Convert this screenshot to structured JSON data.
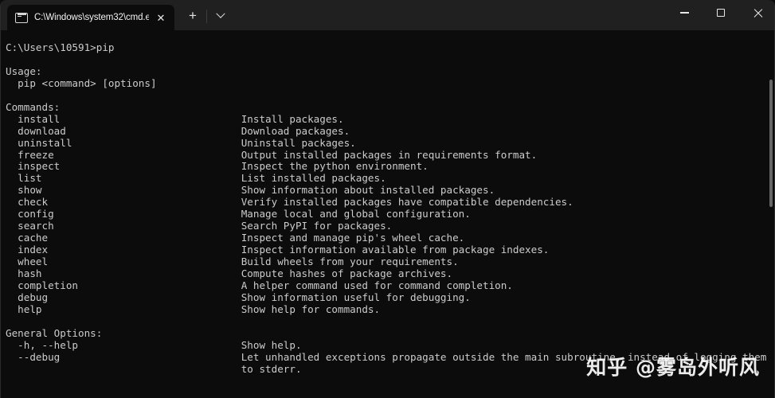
{
  "window": {
    "titlebar": {
      "tab": {
        "icon": "console-icon",
        "title": "C:\\Windows\\system32\\cmd.e:",
        "close_label": "✕"
      },
      "new_tab_label": "+",
      "dropdown_label": "⌄",
      "controls": {
        "minimize": "–",
        "maximize": "□",
        "close": "✕"
      }
    }
  },
  "terminal": {
    "prompt": "C:\\Users\\10591>",
    "command": "pip",
    "prompt_line": "C:\\Users\\10591>pip",
    "usage": {
      "header": "Usage:",
      "line": "  pip <command> [options]"
    },
    "commands": {
      "header": "Commands:",
      "items": [
        {
          "name": "install",
          "description": "Install packages."
        },
        {
          "name": "download",
          "description": "Download packages."
        },
        {
          "name": "uninstall",
          "description": "Uninstall packages."
        },
        {
          "name": "freeze",
          "description": "Output installed packages in requirements format."
        },
        {
          "name": "inspect",
          "description": "Inspect the python environment."
        },
        {
          "name": "list",
          "description": "List installed packages."
        },
        {
          "name": "show",
          "description": "Show information about installed packages."
        },
        {
          "name": "check",
          "description": "Verify installed packages have compatible dependencies."
        },
        {
          "name": "config",
          "description": "Manage local and global configuration."
        },
        {
          "name": "search",
          "description": "Search PyPI for packages."
        },
        {
          "name": "cache",
          "description": "Inspect and manage pip's wheel cache."
        },
        {
          "name": "index",
          "description": "Inspect information available from package indexes."
        },
        {
          "name": "wheel",
          "description": "Build wheels from your requirements."
        },
        {
          "name": "hash",
          "description": "Compute hashes of package archives."
        },
        {
          "name": "completion",
          "description": "A helper command used for command completion."
        },
        {
          "name": "debug",
          "description": "Show information useful for debugging."
        },
        {
          "name": "help",
          "description": "Show help for commands."
        }
      ]
    },
    "general_options": {
      "header": "General Options:",
      "items": [
        {
          "name": "-h, --help",
          "description": "Show help.",
          "continuation": ""
        },
        {
          "name": "--debug",
          "description": "Let unhandled exceptions propagate outside the main subroutine, instead of logging them",
          "continuation": "to stderr."
        }
      ]
    },
    "colors": {
      "background": "#0c0c0c",
      "foreground": "#cccccc",
      "titlebar": "#202020"
    }
  },
  "watermark": {
    "text": "知乎 @雾岛外听风"
  }
}
